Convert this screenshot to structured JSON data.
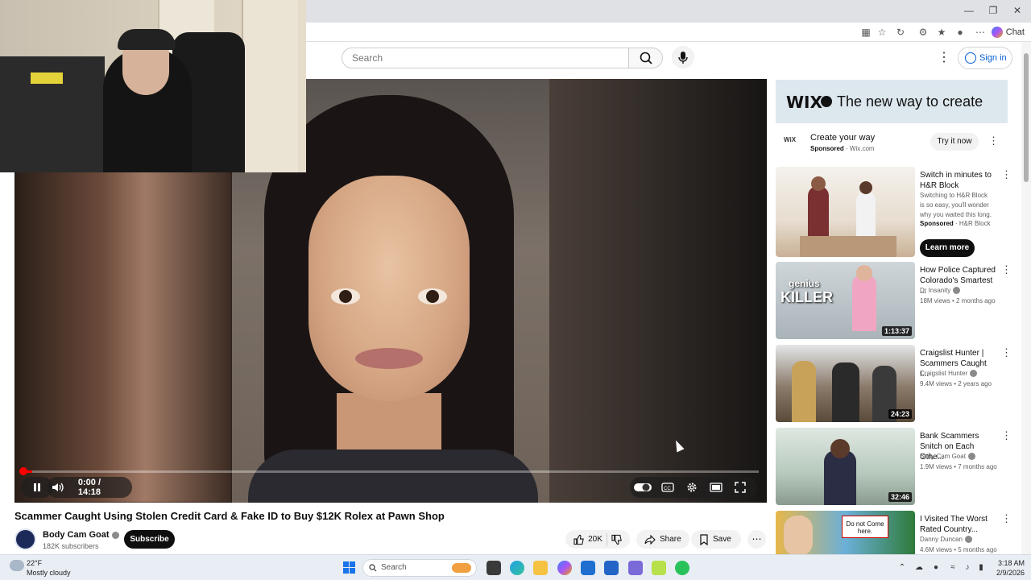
{
  "browser": {
    "chat_label": "Chat"
  },
  "header": {
    "search_placeholder": "Search",
    "signin_label": "Sign in"
  },
  "player": {
    "time": "0:00 / 14:18",
    "progress_fraction": 0.001
  },
  "video": {
    "title": "Scammer Caught Using Stolen Credit Card & Fake ID to Buy $12K Rolex at Pawn Shop",
    "channel": "Body Cam Goat",
    "subscribers": "182K subscribers",
    "subscribe_label": "Subscribe",
    "likes": "20K",
    "share_label": "Share",
    "save_label": "Save"
  },
  "ad": {
    "brand": "WIX",
    "tagline": "The new way to create",
    "mini_logo": "WiX",
    "title": "Create your way",
    "sponsored": "Sponsored",
    "domain": "· Wix.com",
    "cta": "Try it now"
  },
  "recommendations": [
    {
      "title": "Switch in minutes to H&R Block",
      "description": "Switching to H&R Block is so easy, you'll wonder why you waited this long.",
      "sponsored": "Sponsored",
      "advertiser": "· H&R Block",
      "cta": "Learn more"
    },
    {
      "title": "How Police Captured Colorado's Smartest ...",
      "channel": "Dr Insanity",
      "meta": "18M views • 2 months ago",
      "duration": "1:13:37",
      "thumb_text_top": "genius",
      "thumb_text_bottom": "KILLER"
    },
    {
      "title": "Craigslist Hunter | Scammers Caught I...",
      "channel": "Craigslist Hunter",
      "meta": "9.4M views • 2 years ago",
      "duration": "24:23"
    },
    {
      "title": "Bank Scammers Snitch on Each Othe...",
      "channel": "Body Cam Goat",
      "meta": "1.9M views • 7 months ago",
      "duration": "32:46"
    },
    {
      "title": "I Visited The Worst Rated Country...",
      "channel": "Danny Duncan",
      "meta": "4.6M views • 5 months ago",
      "thumb_sign": "Do not Come here."
    }
  ],
  "taskbar": {
    "temperature": "22°F",
    "condition": "Mostly cloudy",
    "search_label": "Search",
    "time": "3:18 AM",
    "date": "2/9/2026"
  },
  "colors": {
    "progress": "#ff0000",
    "link_blue": "#065fd4"
  }
}
